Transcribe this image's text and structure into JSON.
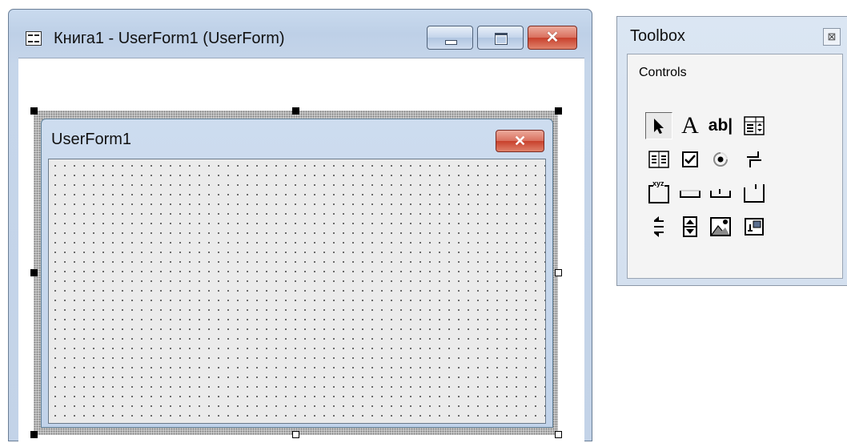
{
  "designer": {
    "title": "Книга1 - UserForm1 (UserForm)",
    "app_icon": "userform-icon",
    "buttons": {
      "minimize": "minimize-icon",
      "maximize": "maximize-icon",
      "close": "✕"
    }
  },
  "userform": {
    "title": "UserForm1",
    "close": "✕"
  },
  "toolbox": {
    "title": "Toolbox",
    "close": "⊠",
    "tab_label": "Controls",
    "tools": [
      "select-objects",
      "label",
      "textbox",
      "combobox",
      "listbox",
      "checkbox",
      "optionbutton",
      "togglebutton",
      "frame",
      "commandbutton",
      "tabstrip",
      "multipage",
      "scrollbar",
      "spinbutton",
      "image",
      "refedit"
    ],
    "label_glyph": "A",
    "textbox_glyph": "ab|",
    "frame_glyph": "xyz"
  },
  "colors": {
    "titlebar": "#c6d6ea",
    "close_button": "#c8402c",
    "grid_background": "#ebebeb"
  }
}
